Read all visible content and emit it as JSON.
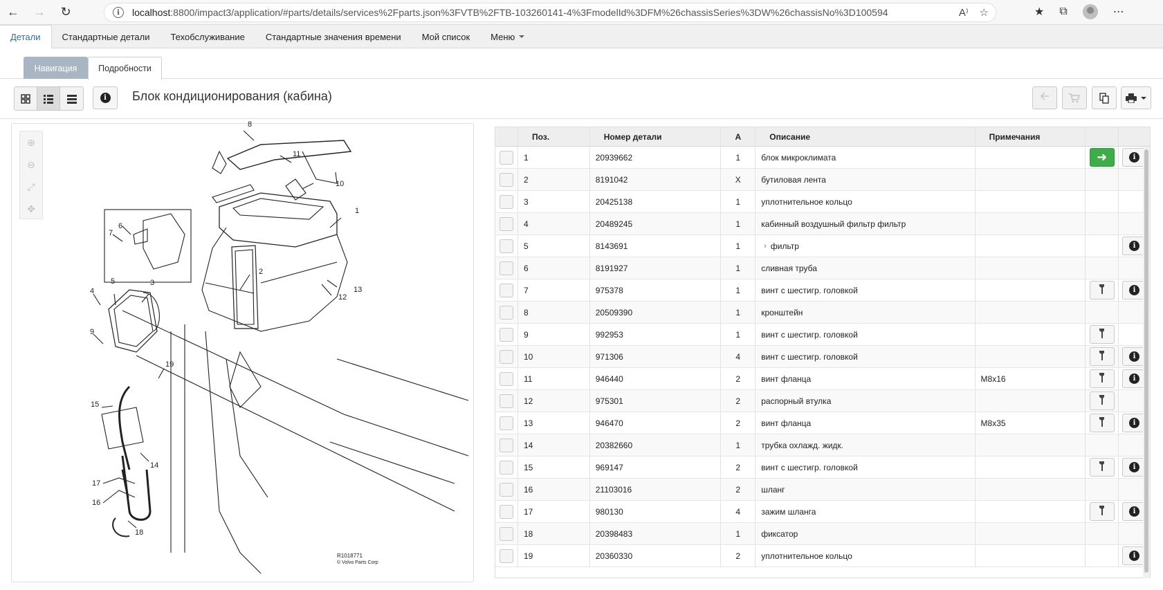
{
  "browser": {
    "url_host": "localhost",
    "url_rest": ":8800/impact3/application/#parts/details/services%2Fparts.json%3FVTB%2FTB-103260141-4%3FmodelId%3DFM%26chassisSeries%3DW%26chassisNo%3D100594"
  },
  "menu": {
    "items": [
      "Детали",
      "Стандартные детали",
      "Техобслуживание",
      "Стандартные значения времени",
      "Мой список",
      "Меню"
    ]
  },
  "subtabs": {
    "navigation": "Навигация",
    "details": "Подробности"
  },
  "page": {
    "title": "Блок кондиционирования (кабина)"
  },
  "diagram": {
    "ref": "R1018771",
    "copyright": "© Volvo Parts Corp"
  },
  "table": {
    "headers": {
      "pos": "Поз.",
      "number": "Номер детали",
      "a": "A",
      "desc": "Описание",
      "note": "Примечания"
    },
    "rows": [
      {
        "pos": "1",
        "number": "20939662",
        "a": "1",
        "desc": "блок микроклимата",
        "note": "",
        "act1": "arrow",
        "info": true
      },
      {
        "pos": "2",
        "number": "8191042",
        "a": "X",
        "desc": "бутиловая лента",
        "note": "",
        "act1": "",
        "info": false
      },
      {
        "pos": "3",
        "number": "20425138",
        "a": "1",
        "desc": "уплотнительное кольцо",
        "note": "",
        "act1": "",
        "info": false
      },
      {
        "pos": "4",
        "number": "20489245",
        "a": "1",
        "desc": "кабинный воздушный фильтр фильтр",
        "note": "",
        "act1": "",
        "info": false
      },
      {
        "pos": "5",
        "number": "8143691",
        "a": "1",
        "desc": "фильтр",
        "note": "",
        "act1": "",
        "info": true,
        "chevron": true
      },
      {
        "pos": "6",
        "number": "8191927",
        "a": "1",
        "desc": "сливная труба",
        "note": "",
        "act1": "",
        "info": false
      },
      {
        "pos": "7",
        "number": "975378",
        "a": "1",
        "desc": "винт с шестигр. головкой",
        "note": "",
        "act1": "tool",
        "info": true
      },
      {
        "pos": "8",
        "number": "20509390",
        "a": "1",
        "desc": "кронштейн",
        "note": "",
        "act1": "",
        "info": false
      },
      {
        "pos": "9",
        "number": "992953",
        "a": "1",
        "desc": "винт с шестигр. головкой",
        "note": "",
        "act1": "tool",
        "info": false
      },
      {
        "pos": "10",
        "number": "971306",
        "a": "4",
        "desc": "винт с шестигр. головкой",
        "note": "",
        "act1": "tool",
        "info": true
      },
      {
        "pos": "11",
        "number": "946440",
        "a": "2",
        "desc": "винт фланца",
        "note": "M8x16",
        "act1": "tool",
        "info": true
      },
      {
        "pos": "12",
        "number": "975301",
        "a": "2",
        "desc": "распорный втулка",
        "note": "",
        "act1": "tool",
        "info": false
      },
      {
        "pos": "13",
        "number": "946470",
        "a": "2",
        "desc": "винт фланца",
        "note": "M8x35",
        "act1": "tool",
        "info": true
      },
      {
        "pos": "14",
        "number": "20382660",
        "a": "1",
        "desc": "трубка охлажд. жидк.",
        "note": "",
        "act1": "",
        "info": false
      },
      {
        "pos": "15",
        "number": "969147",
        "a": "2",
        "desc": "винт с шестигр. головкой",
        "note": "",
        "act1": "tool",
        "info": true
      },
      {
        "pos": "16",
        "number": "21103016",
        "a": "2",
        "desc": "шланг",
        "note": "",
        "act1": "",
        "info": false
      },
      {
        "pos": "17",
        "number": "980130",
        "a": "4",
        "desc": "зажим шланга",
        "note": "",
        "act1": "tool",
        "info": true
      },
      {
        "pos": "18",
        "number": "20398483",
        "a": "1",
        "desc": "фиксатор",
        "note": "",
        "act1": "",
        "info": false
      },
      {
        "pos": "19",
        "number": "20360330",
        "a": "2",
        "desc": "уплотнительное кольцо",
        "note": "",
        "act1": "",
        "info": true
      }
    ]
  },
  "diagram_callouts": [
    "1",
    "2",
    "3",
    "4",
    "5",
    "6",
    "7",
    "8",
    "9",
    "10",
    "11",
    "12",
    "13",
    "14",
    "15",
    "16",
    "17",
    "18",
    "19"
  ]
}
